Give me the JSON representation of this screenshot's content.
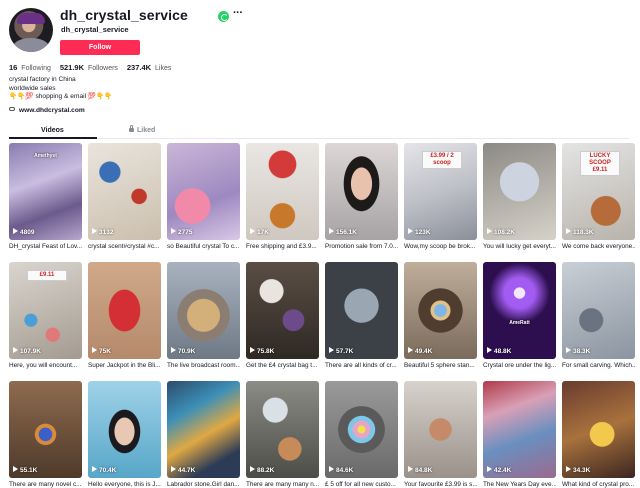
{
  "profile": {
    "username": "dh_crystal_service",
    "nickname": "dh_crystal_service",
    "follow_label": "Follow",
    "more_label": "···",
    "stats": [
      {
        "value": "16",
        "label": "Following"
      },
      {
        "value": "521.9K",
        "label": "Followers"
      },
      {
        "value": "237.4K",
        "label": "Likes"
      }
    ],
    "bio": [
      "crystal factory in China",
      "worldwide sales",
      "👇👇💯 shopping & email 💯👇👇"
    ],
    "link": "www.dhdcrystal.com"
  },
  "tabs": {
    "videos": "Videos",
    "liked": "Liked"
  },
  "videos": [
    {
      "views": "4809",
      "caption": "DH_crystal Feast of Lov...",
      "overlay": "Amethyst"
    },
    {
      "views": "3132",
      "caption": "crystal scent#crystal #c..."
    },
    {
      "views": "2775",
      "caption": "so Beautiful crystal To c..."
    },
    {
      "views": "17K",
      "caption": "Free shipping and £3.9..."
    },
    {
      "views": "156.1K",
      "caption": "Promotion sale from 7.0..."
    },
    {
      "views": "123K",
      "caption": "Wow,my scoop be brok...",
      "sign": "£3.99 / 2 scoop"
    },
    {
      "views": "108.2K",
      "caption": "You will lucky get everyt..."
    },
    {
      "views": "118.3K",
      "caption": "We come back everyone...",
      "sign": "LUCKY SCOOP £9.11"
    },
    {
      "views": "107.9K",
      "caption": "Here,  you will encount...",
      "sign": "£9.11"
    },
    {
      "views": "75K",
      "caption": "Super Jackpot in the Bli..."
    },
    {
      "views": "70.9K",
      "caption": "The live broadcast room..."
    },
    {
      "views": "75.8K",
      "caption": "Get the £4 crystal bag t..."
    },
    {
      "views": "57.7K",
      "caption": "There are all kinds of cr..."
    },
    {
      "views": "49.4K",
      "caption": "Beautiful 5 sphere stan..."
    },
    {
      "views": "48.8K",
      "caption": "Crystal ore under the lig...",
      "overlay": "AmeRatt"
    },
    {
      "views": "38.3K",
      "caption": "For small carving. Which..."
    },
    {
      "views": "55.1K",
      "caption": "There are many novel c..."
    },
    {
      "views": "70.4K",
      "caption": "Hello everyone, this is J..."
    },
    {
      "views": "44.7K",
      "caption": "Labrador stone.Girl dan..."
    },
    {
      "views": "88.2K",
      "caption": "There are many many n..."
    },
    {
      "views": "84.6K",
      "caption": "£ 5 off for all new custo..."
    },
    {
      "views": "84.8K",
      "caption": "Your favourite £3.99 is s..."
    },
    {
      "views": "42.4K",
      "caption": "The New Years Day eve..."
    },
    {
      "views": "34.3K",
      "caption": "What kind of crystal pro..."
    }
  ],
  "colors": {
    "follow": "#fe2c55",
    "whatsapp": "#25d366",
    "text": "#161823"
  }
}
